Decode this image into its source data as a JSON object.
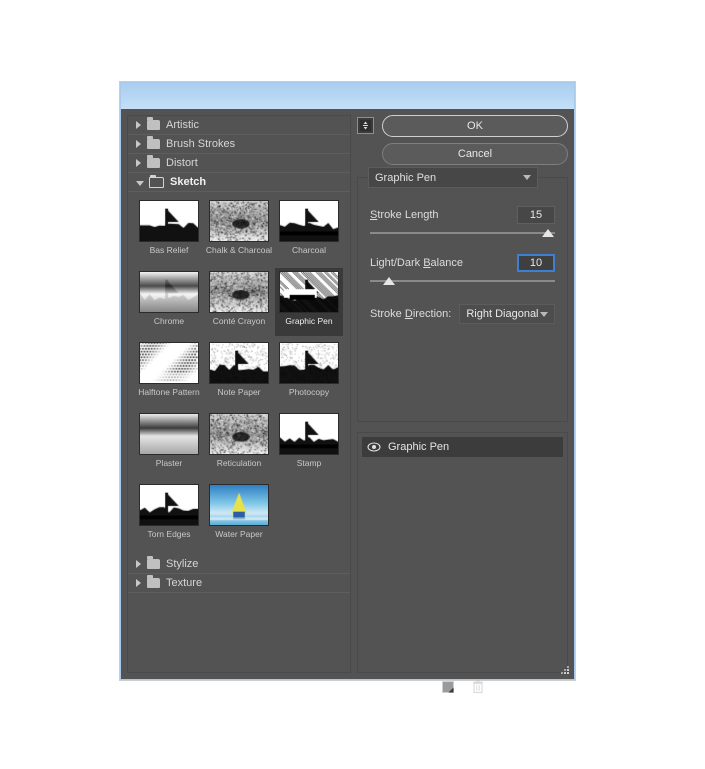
{
  "window": {
    "title": ""
  },
  "browser": {
    "categories": [
      {
        "label": "Artistic",
        "expanded": false
      },
      {
        "label": "Brush Strokes",
        "expanded": false
      },
      {
        "label": "Distort",
        "expanded": false
      },
      {
        "label": "Sketch",
        "expanded": true
      }
    ],
    "trailing_categories": [
      {
        "label": "Stylize",
        "expanded": false
      },
      {
        "label": "Texture",
        "expanded": false
      }
    ],
    "filters": [
      {
        "label": "Bas Relief",
        "selected": false,
        "style": "bas-relief"
      },
      {
        "label": "Chalk & Charcoal",
        "selected": false,
        "style": "chalk"
      },
      {
        "label": "Charcoal",
        "selected": false,
        "style": "charcoal"
      },
      {
        "label": "Chrome",
        "selected": false,
        "style": "chrome"
      },
      {
        "label": "Conté Crayon",
        "selected": false,
        "style": "conte"
      },
      {
        "label": "Graphic Pen",
        "selected": true,
        "style": "graphicpen"
      },
      {
        "label": "Halftone Pattern",
        "selected": false,
        "style": "halftone"
      },
      {
        "label": "Note Paper",
        "selected": false,
        "style": "notepaper"
      },
      {
        "label": "Photocopy",
        "selected": false,
        "style": "photocopy"
      },
      {
        "label": "Plaster",
        "selected": false,
        "style": "plaster"
      },
      {
        "label": "Reticulation",
        "selected": false,
        "style": "reticulation"
      },
      {
        "label": "Stamp",
        "selected": false,
        "style": "stamp"
      },
      {
        "label": "Torn Edges",
        "selected": false,
        "style": "tornedges"
      },
      {
        "label": "Water Paper",
        "selected": false,
        "style": "waterpaper"
      }
    ]
  },
  "buttons": {
    "ok": "OK",
    "cancel": "Cancel",
    "collapse_icon": "collapse-panel-icon"
  },
  "params": {
    "filter_name": "Graphic Pen",
    "stroke_length": {
      "label": "Stroke Length",
      "label_prefix": "S",
      "label_rest": "troke Length",
      "value": "15",
      "percent": 96
    },
    "light_dark_balance": {
      "label": "Light/Dark Balance",
      "label_prefix": "Light/Dark ",
      "label_mnemonic": "B",
      "label_rest": "alance",
      "value": "10",
      "percent": 10,
      "focused": true
    },
    "stroke_direction": {
      "label_prefix": "Stroke ",
      "label_mnemonic": "D",
      "label_rest": "irection:",
      "value": "Right Diagonal"
    }
  },
  "layers": {
    "items": [
      {
        "name": "Graphic Pen",
        "visible": true
      }
    ],
    "toolbar": {
      "new_layer_icon": "new-effect-layer-icon",
      "delete_layer_icon": "delete-effect-layer-icon"
    }
  }
}
